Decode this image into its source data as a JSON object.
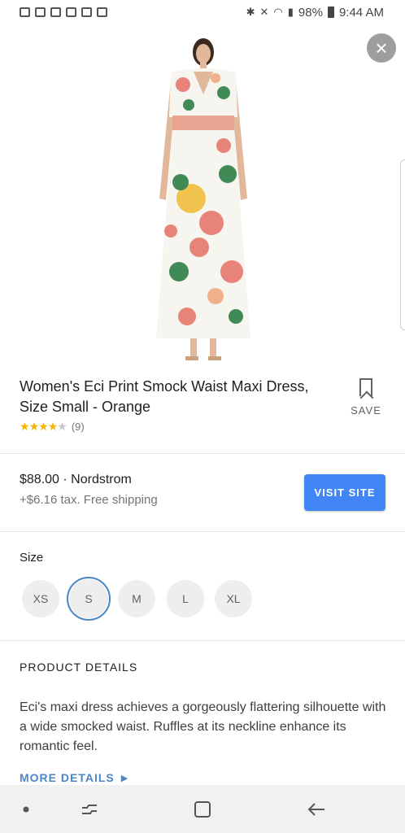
{
  "status_bar": {
    "battery": "98%",
    "time": "9:44 AM"
  },
  "product": {
    "title": "Women's Eci Print Smock Waist Maxi Dress, Size Small - Orange",
    "save_label": "SAVE",
    "rating_value": 4,
    "rating_max": 5,
    "review_count": "(9)"
  },
  "offer": {
    "price_line": "$88.00 · Nordstrom",
    "shipping_line": "+$6.16 tax. Free shipping",
    "visit_label": "VISIT SITE"
  },
  "sizes": {
    "label": "Size",
    "options": [
      "XS",
      "S",
      "M",
      "L",
      "XL"
    ],
    "selected": "S"
  },
  "details": {
    "heading": "PRODUCT DETAILS",
    "text": "Eci's maxi dress achieves a gorgeously flattering silhouette with a wide smocked waist. Ruffles at its neckline enhance its romantic feel.",
    "more_label": "MORE DETAILS"
  },
  "colors": {
    "accent": "#4285f4",
    "link": "#4a86c5",
    "star": "#f4b400"
  }
}
